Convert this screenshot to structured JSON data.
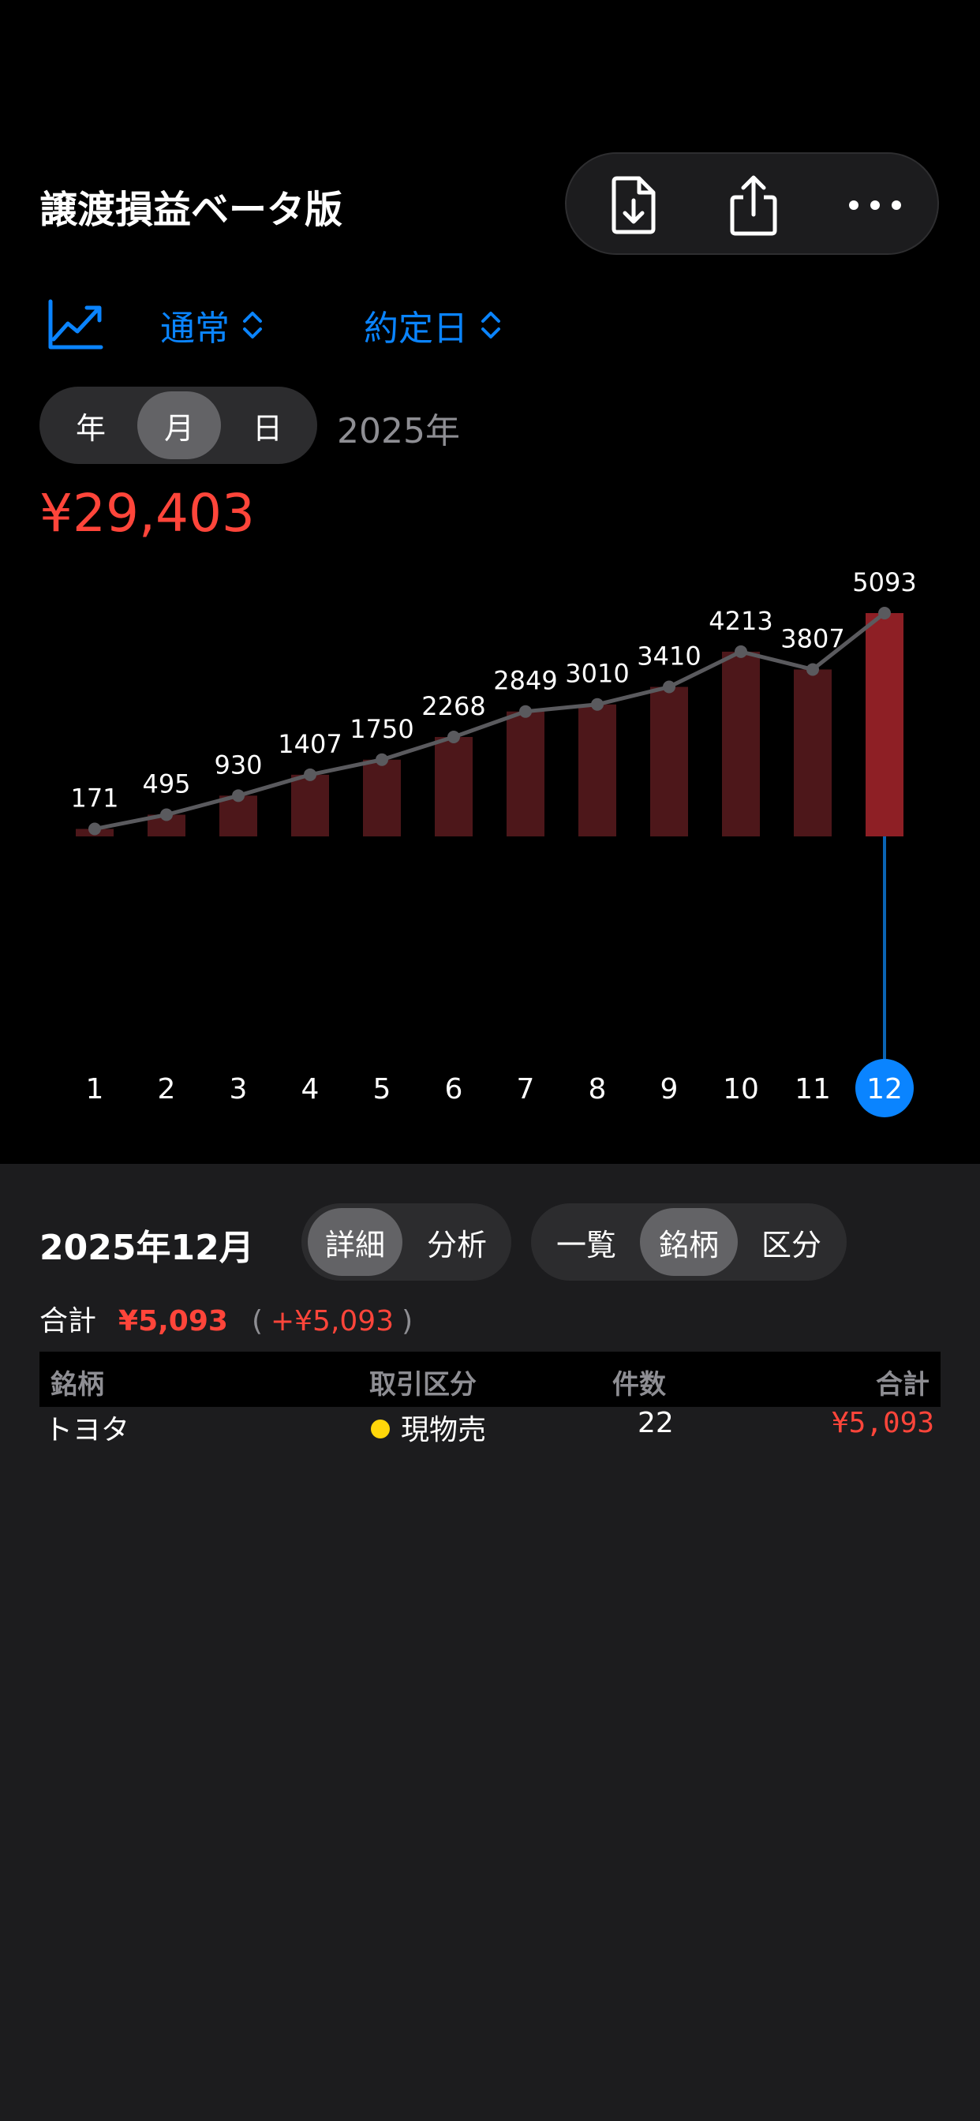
{
  "header": {
    "title": "譲渡損益ベータ版"
  },
  "toolbar": {
    "icons": [
      "doc-download-icon",
      "share-icon",
      "ellipsis-icon"
    ]
  },
  "filters": {
    "mode": "通常",
    "date_basis": "約定日"
  },
  "period_tabs": {
    "items": [
      "年",
      "月",
      "日"
    ],
    "selected": "月"
  },
  "year_label": "2025年",
  "total": "¥29,403",
  "colors": {
    "accent": "#0a84ff",
    "loss_red": "#ff453a",
    "bar_dark": "#4d171a",
    "bar_selected": "#8e1f25",
    "line": "#5a5a5e",
    "dot_yellow": "#ffd60a"
  },
  "chart_data": {
    "type": "bar",
    "categories": [
      "1",
      "2",
      "3",
      "4",
      "5",
      "6",
      "7",
      "8",
      "9",
      "10",
      "11",
      "12"
    ],
    "series": [
      {
        "values": [
          171,
          495,
          930,
          1407,
          1750,
          2268,
          2849,
          3010,
          3410,
          4213,
          3807,
          5093
        ]
      }
    ],
    "overlay": "line",
    "selected": "12",
    "ylim": [
      0,
      5093
    ],
    "grid": false,
    "legend": "none"
  },
  "detail": {
    "title": "2025年12月",
    "view_tabs": {
      "items": [
        "詳細",
        "分析"
      ],
      "selected": "詳細"
    },
    "group_tabs": {
      "items": [
        "一覧",
        "銘柄",
        "区分"
      ],
      "selected": "銘柄"
    },
    "summary": {
      "label": "合計",
      "value": "¥5,093",
      "open": "(",
      "delta": "+¥5,093",
      "close": ")"
    },
    "table": {
      "columns": [
        "銘柄",
        "取引区分",
        "件数",
        "合計"
      ],
      "rows": [
        {
          "name": "トヨタ",
          "type": "現物売",
          "count": "22",
          "total": "¥5,093"
        }
      ]
    }
  }
}
